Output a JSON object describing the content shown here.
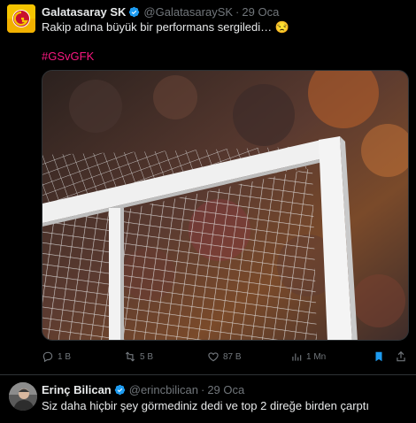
{
  "tweet1": {
    "name": "Galatasaray SK",
    "handle": "@GalatasaraySK",
    "dot": "·",
    "date": "29 Oca",
    "text": "Rakip adına büyük bir performans sergiledi… 😒",
    "hashtag": "#GSvGFK",
    "stats": {
      "replies": "1 B",
      "retweets": "5 B",
      "likes": "87 B",
      "views": "1 Mn"
    }
  },
  "tweet2": {
    "name": "Erinç Bilican",
    "handle": "@erincbilican",
    "dot": "·",
    "date": "29 Oca",
    "text": "Siz daha hiçbir şey görmediniz dedi ve top 2 direğe birden çarptı"
  },
  "colors": {
    "background": "#000000",
    "text": "#e7e9ea",
    "muted": "#71767b",
    "hashtag": "#f91880",
    "verified": "#1d9bf0",
    "bookmark": "#1d9bf0",
    "border": "#2f3336"
  }
}
